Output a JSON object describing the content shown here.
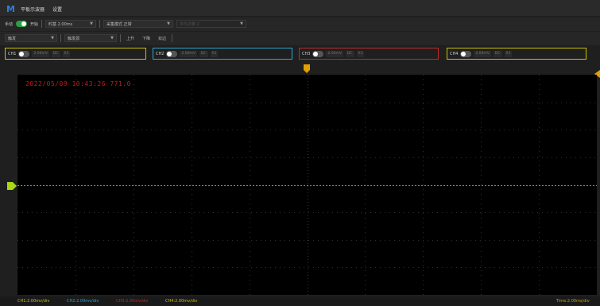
{
  "titlebar": {
    "app_name": "平板示波器",
    "settings_menu": "设置"
  },
  "toolbar1": {
    "run_label": "手动",
    "toggle_state_label": "开始",
    "timebase_select": "时基 2.00ms",
    "acq_mode_select": "采集模式 正常",
    "extra_select": "平均次数 2"
  },
  "toolbar2": {
    "trigger_select": "触发",
    "edge_select": "触发源",
    "rise_button": "上升",
    "fall_button": "下降",
    "both_button": "双边"
  },
  "channels": [
    {
      "label": "CH1",
      "scale": "2.00mV",
      "coupling": "DC",
      "probe": "X1",
      "color": "#c9c200"
    },
    {
      "label": "CH2",
      "scale": "2.00mV",
      "coupling": "DC",
      "probe": "X1",
      "color": "#2aa5d0"
    },
    {
      "label": "CH3",
      "scale": "2.00mV",
      "coupling": "DC",
      "probe": "X1",
      "color": "#c02a2a"
    },
    {
      "label": "CH4",
      "scale": "2.00mV",
      "coupling": "DC",
      "probe": "X1",
      "color": "#c9c200"
    }
  ],
  "plot": {
    "timestamp": "2022/05/09 10:43:26 771.0"
  },
  "statusbar": {
    "ch1": "CH1:2.00mv/div",
    "ch2": "CH2:2.00mv/div",
    "ch3": "CH3:2.00mv/div",
    "ch4": "CH4:2.00mv/div",
    "timebase": "Time:2.00ms/div"
  },
  "colors": {
    "ch1": "#c9c200",
    "ch2": "#2aa5d0",
    "ch3": "#c02a2a",
    "ch4": "#c9c200",
    "trigger": "#e0a000",
    "toggle_on": "#2ea043",
    "ground_marker": "#a8d818"
  }
}
